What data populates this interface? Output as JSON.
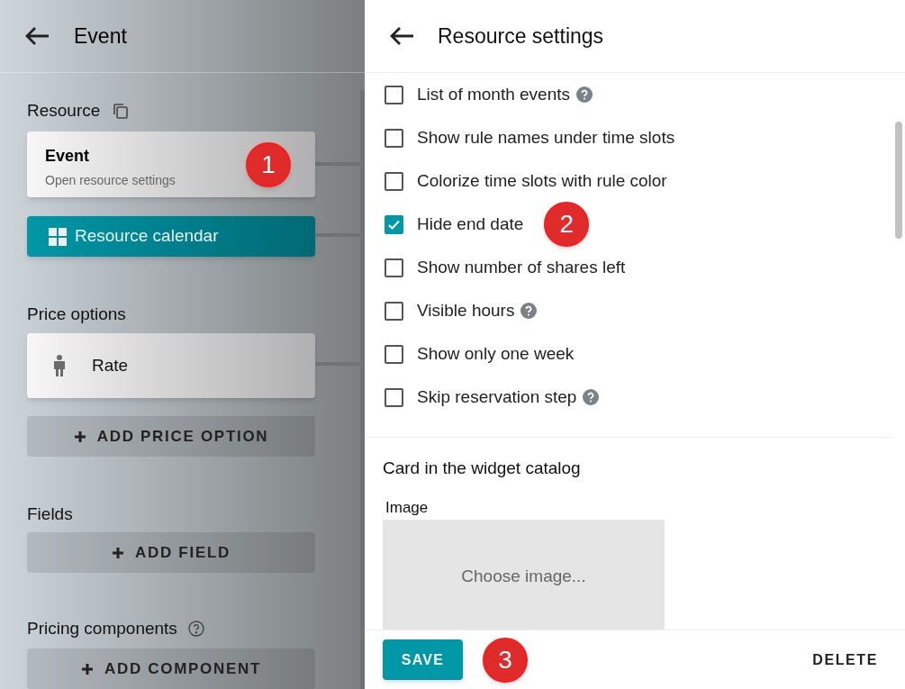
{
  "left_panel": {
    "title": "Event",
    "resource": {
      "label": "Resource",
      "card": {
        "title": "Event",
        "subtitle": "Open resource settings",
        "callout": "1"
      },
      "calendar_button": "Resource calendar"
    },
    "price_options": {
      "label": "Price options",
      "items": [
        {
          "label": "Rate"
        }
      ],
      "add_button": "ADD PRICE OPTION"
    },
    "fields": {
      "label": "Fields",
      "add_button": "ADD FIELD"
    },
    "pricing_components": {
      "label": "Pricing components",
      "add_button": "ADD COMPONENT"
    }
  },
  "settings_panel": {
    "title": "Resource settings",
    "options": [
      {
        "label": "List of month events",
        "checked": false,
        "help": true
      },
      {
        "label": "Show rule names under time slots",
        "checked": false,
        "help": false
      },
      {
        "label": "Colorize time slots with rule color",
        "checked": false,
        "help": false
      },
      {
        "label": "Hide end date",
        "checked": true,
        "help": false,
        "callout": "2"
      },
      {
        "label": "Show number of shares left",
        "checked": false,
        "help": false
      },
      {
        "label": "Visible hours",
        "checked": false,
        "help": true
      },
      {
        "label": "Show only one week",
        "checked": false,
        "help": false
      },
      {
        "label": "Skip reservation step",
        "checked": false,
        "help": true
      }
    ],
    "catalog_card": {
      "heading": "Card in the widget catalog",
      "image_label": "Image",
      "image_placeholder": "Choose image..."
    },
    "footer": {
      "save": "SAVE",
      "callout": "3",
      "delete": "DELETE"
    }
  }
}
